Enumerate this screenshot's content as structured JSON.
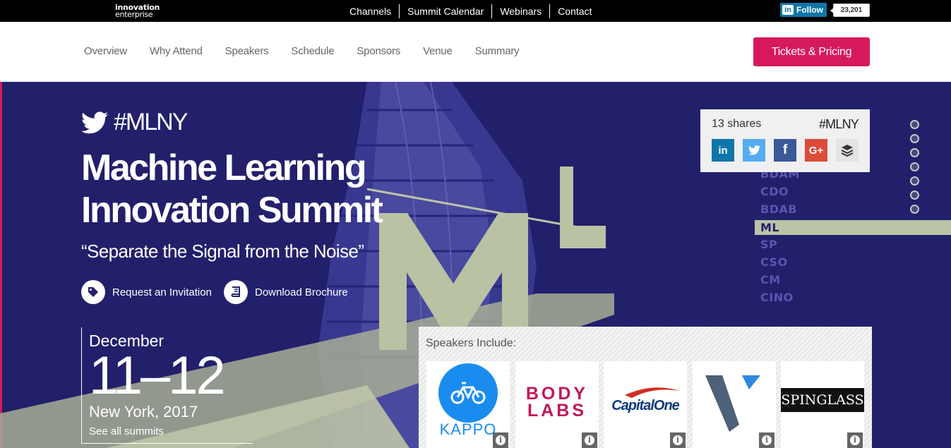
{
  "brand": {
    "line1": "innovation",
    "line2": "enterprise"
  },
  "topnav": [
    "Channels",
    "Summit Calendar",
    "Webinars",
    "Contact"
  ],
  "linkedin": {
    "in": "in",
    "follow": "Follow",
    "count": "23,201"
  },
  "subnav": [
    "Overview",
    "Why Attend",
    "Speakers",
    "Schedule",
    "Sponsors",
    "Venue",
    "Summary"
  ],
  "tickets": "Tickets & Pricing",
  "hero": {
    "hashtag": "#MLNY",
    "title_line1": "Machine Learning",
    "title_line2": "Innovation Summit",
    "tagline": "“Separate the Signal from the Noise”",
    "cta_invite": "Request an Invitation",
    "cta_brochure": "Download Brochure",
    "month": "December",
    "days": "11–12",
    "location": "New York, 2017",
    "see_all": "See all summits",
    "big_letters": "ML"
  },
  "share": {
    "count": "13 shares",
    "hashtag": "#MLNY",
    "buttons": [
      {
        "label": "in",
        "color": "#0e76a8",
        "icon": "linkedin-icon"
      },
      {
        "label": "t",
        "color": "#55acee",
        "icon": "twitter-icon"
      },
      {
        "label": "f",
        "color": "#3b5998",
        "icon": "facebook-icon"
      },
      {
        "label": "G+",
        "color": "#dd4b39",
        "icon": "google-plus-icon"
      },
      {
        "label": "",
        "color": "#e4e4e4",
        "icon": "buffer-icon"
      }
    ]
  },
  "acronyms": [
    "BDAM",
    "CDO",
    "BDAB",
    "ML",
    "SP",
    "CSO",
    "CM",
    "CINO"
  ],
  "acronym_active": "ML",
  "slide_dots": 7,
  "speakers": {
    "heading": "Speakers Include:",
    "logos": [
      {
        "name": "KAPPO",
        "color": "#1a8cf0"
      },
      {
        "name_line1": "BODY",
        "name_line2": "LABS",
        "color": "#c2185b"
      },
      {
        "name": "CapitalOne",
        "color": "#0c3b7c"
      },
      {
        "name": "V",
        "color": "#4d6178"
      },
      {
        "name": "SPINGLASS",
        "color": "#111111"
      }
    ],
    "info_label": "i"
  },
  "colors": {
    "accent": "#d6195f",
    "hero_bg": "#22206b",
    "sage": "#bcc4a7"
  }
}
